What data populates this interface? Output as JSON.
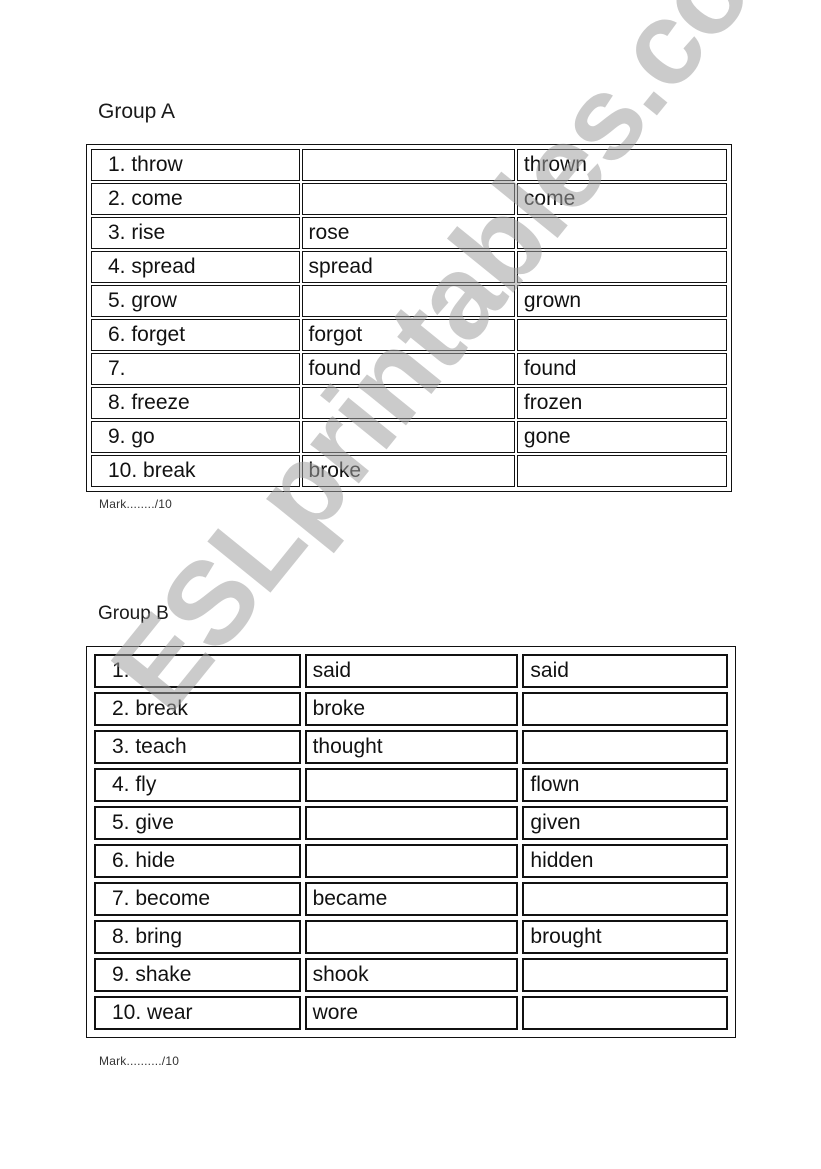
{
  "groups": [
    {
      "title": "Group A",
      "rows": [
        [
          "1. throw",
          "",
          "thrown"
        ],
        [
          "2. come",
          "",
          "come"
        ],
        [
          "3. rise",
          "rose",
          ""
        ],
        [
          "4. spread",
          "spread",
          ""
        ],
        [
          "5. grow",
          "",
          "grown"
        ],
        [
          "6. forget",
          "forgot",
          ""
        ],
        [
          "7.",
          "found",
          "found"
        ],
        [
          "8. freeze",
          "",
          "frozen"
        ],
        [
          "9. go",
          "",
          "gone"
        ],
        [
          "10. break",
          "broke",
          ""
        ]
      ],
      "mark": "Mark......../10"
    },
    {
      "title": "Group B",
      "rows": [
        [
          "1.",
          "said",
          "said"
        ],
        [
          "2. break",
          "broke",
          ""
        ],
        [
          "3. teach",
          "thought",
          ""
        ],
        [
          "4. fly",
          "",
          "flown"
        ],
        [
          "5. give",
          "",
          "given"
        ],
        [
          "6. hide",
          "",
          "hidden"
        ],
        [
          "7. become",
          "became",
          ""
        ],
        [
          "8. bring",
          "",
          "brought"
        ],
        [
          "9. shake",
          "shook",
          ""
        ],
        [
          "10. wear",
          "wore",
          ""
        ]
      ],
      "mark": "Mark........../10"
    }
  ],
  "watermark": "ESLprintables.com"
}
